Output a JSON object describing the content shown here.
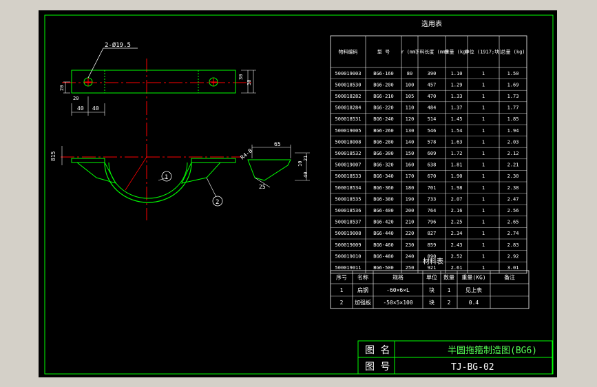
{
  "selection_table": {
    "title": "选用表",
    "headers": [
      "物料编码",
      "型 号",
      "r (mm)",
      "下料长度 (mm)",
      "重量 (kg)",
      "单位 (1917;块)",
      "总量 (kg)"
    ],
    "rows": [
      [
        "500019003",
        "BG6-160",
        "80",
        "390",
        "1.10",
        "1",
        "1.50"
      ],
      [
        "500018530",
        "BG6-200",
        "100",
        "457",
        "1.29",
        "1",
        "1.69"
      ],
      [
        "500018282",
        "BG6-210",
        "105",
        "470",
        "1.33",
        "1",
        "1.73"
      ],
      [
        "500018284",
        "BG6-220",
        "110",
        "484",
        "1.37",
        "1",
        "1.77"
      ],
      [
        "500018531",
        "BG6-240",
        "120",
        "514",
        "1.45",
        "1",
        "1.85"
      ],
      [
        "500019005",
        "BG6-260",
        "130",
        "546",
        "1.54",
        "1",
        "1.94"
      ],
      [
        "500018008",
        "BG6-280",
        "140",
        "578",
        "1.63",
        "1",
        "2.03"
      ],
      [
        "500018532",
        "BG6-300",
        "150",
        "609",
        "1.72",
        "1",
        "2.12"
      ],
      [
        "500019007",
        "BG6-320",
        "160",
        "638",
        "1.81",
        "1",
        "2.21"
      ],
      [
        "500018533",
        "BG6-340",
        "170",
        "670",
        "1.90",
        "1",
        "2.30"
      ],
      [
        "500018534",
        "BG6-360",
        "180",
        "701",
        "1.98",
        "1",
        "2.38"
      ],
      [
        "500018535",
        "BG6-380",
        "190",
        "733",
        "2.07",
        "1",
        "2.47"
      ],
      [
        "500018536",
        "BG6-400",
        "200",
        "764",
        "2.16",
        "1",
        "2.56"
      ],
      [
        "500018537",
        "BG6-420",
        "210",
        "796",
        "2.25",
        "1",
        "2.65"
      ],
      [
        "500019008",
        "BG6-440",
        "220",
        "827",
        "2.34",
        "1",
        "2.74"
      ],
      [
        "500019009",
        "BG6-460",
        "230",
        "859",
        "2.43",
        "1",
        "2.83"
      ],
      [
        "500019010",
        "BG6-480",
        "240",
        "890",
        "2.52",
        "1",
        "2.92"
      ],
      [
        "500019011",
        "BG6-500",
        "250",
        "921",
        "2.61",
        "1",
        "3.01"
      ]
    ]
  },
  "material_table": {
    "title": "材料表",
    "headers": [
      "序号",
      "名称",
      "规格",
      "单位",
      "数量",
      "重量(KG)",
      "备注"
    ],
    "rows": [
      [
        "1",
        "扁钢",
        "-60×6×L",
        "块",
        "1",
        "见上表",
        ""
      ],
      [
        "2",
        "加强板",
        "-50×5×100",
        "块",
        "2",
        "0.4",
        ""
      ]
    ]
  },
  "title_block": {
    "name_label": "图 名",
    "name_value": "半圆拖箍制造图(BG6)",
    "number_label": "图 号",
    "number_value": "TJ-BG-02"
  },
  "drawing_labels": {
    "hole_note": "2-Ø19.5",
    "dim_30_a": "30",
    "dim_30_b": "30",
    "dim_20": "20",
    "dim_20b": "20",
    "dim_40_a": "40",
    "dim_40_b": "40",
    "dim_65": "65",
    "r4": "R4-8",
    "dim_25": "25",
    "dim_40c": "40",
    "dim_10": "10",
    "dim_21": "21",
    "dim_815": "815",
    "callout_1": "1",
    "callout_2": "2"
  },
  "colors": {
    "background": "#000000",
    "frame": "#00ff00",
    "centerline": "#ff0000",
    "part": "#00ff00",
    "text": "#ffffff",
    "title_text": "#55ff55"
  }
}
